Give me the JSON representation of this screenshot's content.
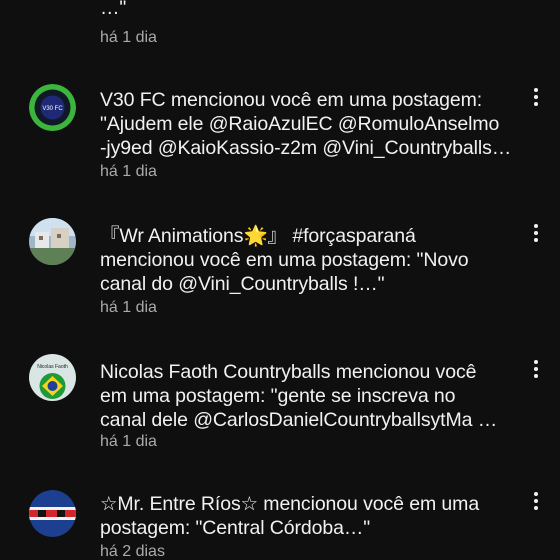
{
  "notifications": [
    {
      "lines": [
        "…\""
      ],
      "time": "há 1 dia",
      "has_avatar": false,
      "has_menu": false
    },
    {
      "lines": [
        "V30 FC mencionou você em uma postagem:",
        "\"Ajudem ele @RaioAzulEC @RomuloAnselmo",
        "-jy9ed @KaioKassio-z2m @Vini_Countryballs…"
      ],
      "time": "há 1 dia",
      "avatar_text": "V30 FC",
      "has_avatar": true,
      "has_menu": true
    },
    {
      "lines": [
        "『Wr Animations🌟』 #forçasparaná",
        "mencionou você em uma postagem: \"Novo",
        "canal do @Vini_Countryballs !…\""
      ],
      "time": "há 1 dia",
      "has_avatar": true,
      "has_menu": true
    },
    {
      "lines": [
        "Nicolas Faoth Countryballs mencionou você",
        "em uma postagem: \"gente se inscreva no",
        "canal dele @CarlosDanielCountryballsytMa …"
      ],
      "time": "há 1 dia",
      "avatar_text": "Nicolas Faoth",
      "has_avatar": true,
      "has_menu": true
    },
    {
      "lines": [
        "☆Mr. Entre Ríos☆ mencionou você em uma",
        "postagem: \"Central Córdoba…\""
      ],
      "time": "há 2 dias",
      "has_avatar": true,
      "has_menu": true
    }
  ],
  "colors": {
    "background": "#0f0f0f",
    "text_primary": "#f1f1f1",
    "text_secondary": "#aaaaaa"
  },
  "icons": {
    "menu": "more-vert-icon"
  }
}
